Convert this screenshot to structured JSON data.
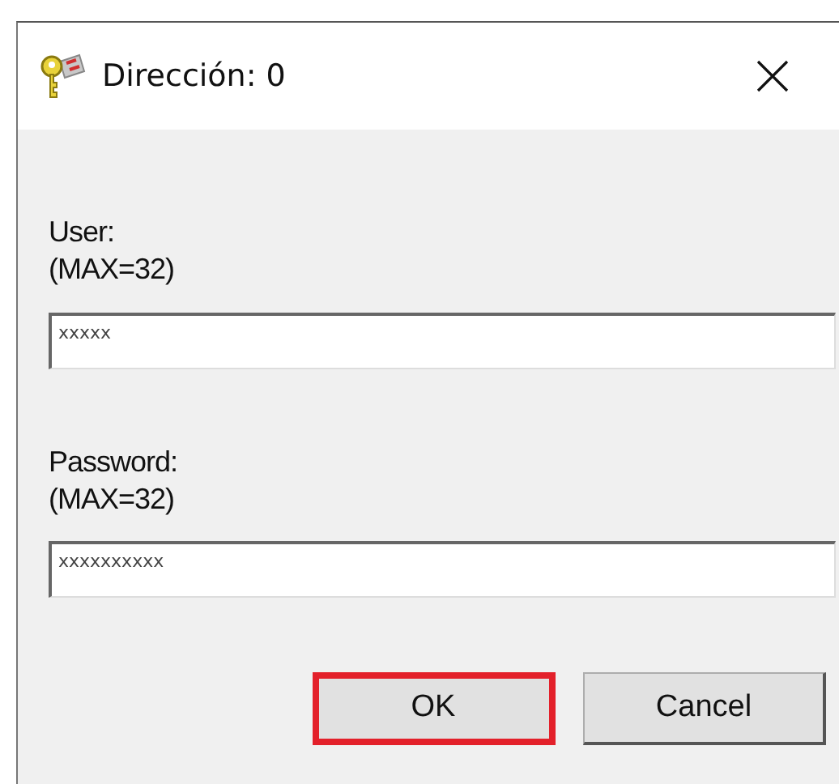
{
  "window": {
    "title": "Dirección: 0"
  },
  "fields": [
    {
      "label": "User:",
      "hint": "(MAX=32)",
      "value": "xxxxx"
    },
    {
      "label": "Password:",
      "hint": "(MAX=32)",
      "value": "xxxxxxxxxx"
    }
  ],
  "buttons": [
    {
      "label": "OK",
      "highlighted": true
    },
    {
      "label": "Cancel",
      "highlighted": false
    }
  ]
}
